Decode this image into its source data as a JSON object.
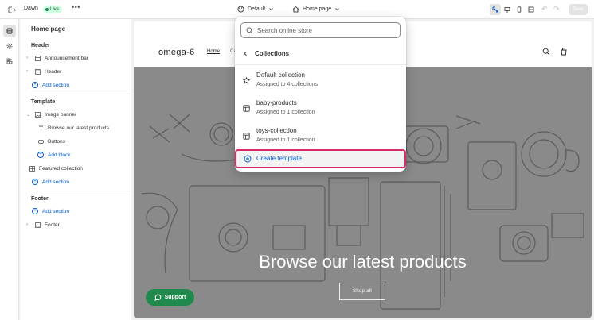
{
  "topbar": {
    "theme_name": "Dawn",
    "live_label": "Live",
    "more_label": "•••",
    "template_select": "Default",
    "page_select": "Home page",
    "save_label": "Save"
  },
  "sidebar": {
    "title": "Home page",
    "header_section": "Header",
    "header_items": [
      "Announcement bar",
      "Header"
    ],
    "add_section": "Add section",
    "template_section": "Template",
    "image_banner": "Image banner",
    "banner_children": [
      "Browse our latest products",
      "Buttons"
    ],
    "add_block": "Add block",
    "featured_collection": "Featured collection",
    "footer_section": "Footer",
    "footer_item": "Footer"
  },
  "preview": {
    "logo": "omega-6",
    "nav_home": "Home",
    "nav_catalog": "Ca",
    "banner_title": "Browse our latest products",
    "shop_button": "Shop all",
    "support_button": "Support"
  },
  "dropdown": {
    "search_placeholder": "Search online store",
    "back_label": "Collections",
    "items": [
      {
        "title": "Default collection",
        "subtitle": "Assigned to 4 collections",
        "icon": "star-icon"
      },
      {
        "title": "baby-products",
        "subtitle": "Assigned to 1 collection",
        "icon": "template-icon"
      },
      {
        "title": "toys-collection",
        "subtitle": "Assigned to 1 collection",
        "icon": "template-icon"
      }
    ],
    "create_label": "Create template"
  },
  "colors": {
    "accent": "#005bd3",
    "live_badge": "#cdfee1",
    "highlight_border": "#d72c6c",
    "support_green": "#1f8a4c",
    "banner_gray": "#8a8a8a"
  }
}
